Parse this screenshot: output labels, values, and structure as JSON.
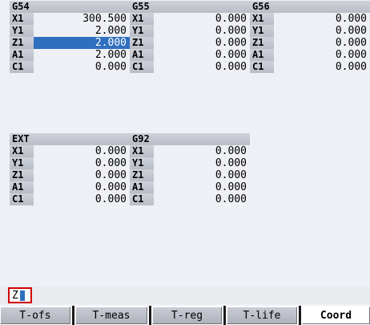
{
  "g54": {
    "title": "G54",
    "rows": [
      {
        "axis": "X1",
        "value": "300.500"
      },
      {
        "axis": "Y1",
        "value": "2.000"
      },
      {
        "axis": "Z1",
        "value": "2.000"
      },
      {
        "axis": "A1",
        "value": "2.000"
      },
      {
        "axis": "C1",
        "value": "0.000"
      }
    ]
  },
  "g55": {
    "title": "G55",
    "rows": [
      {
        "axis": "X1",
        "value": "0.000"
      },
      {
        "axis": "Y1",
        "value": "0.000"
      },
      {
        "axis": "Z1",
        "value": "0.000"
      },
      {
        "axis": "A1",
        "value": "0.000"
      },
      {
        "axis": "C1",
        "value": "0.000"
      }
    ]
  },
  "g56": {
    "title": "G56",
    "rows": [
      {
        "axis": "X1",
        "value": "0.000"
      },
      {
        "axis": "Y1",
        "value": "0.000"
      },
      {
        "axis": "Z1",
        "value": "0.000"
      },
      {
        "axis": "A1",
        "value": "0.000"
      },
      {
        "axis": "C1",
        "value": "0.000"
      }
    ]
  },
  "ext": {
    "title": "EXT",
    "rows": [
      {
        "axis": "X1",
        "value": "0.000"
      },
      {
        "axis": "Y1",
        "value": "0.000"
      },
      {
        "axis": "Z1",
        "value": "0.000"
      },
      {
        "axis": "A1",
        "value": "0.000"
      },
      {
        "axis": "C1",
        "value": "0.000"
      }
    ]
  },
  "g92": {
    "title": "G92",
    "rows": [
      {
        "axis": "X1",
        "value": "0.000"
      },
      {
        "axis": "Y1",
        "value": "0.000"
      },
      {
        "axis": "Z1",
        "value": "0.000"
      },
      {
        "axis": "A1",
        "value": "0.000"
      },
      {
        "axis": "C1",
        "value": "0.000"
      }
    ]
  },
  "input": {
    "value": "Z"
  },
  "softkeys": {
    "t_ofs": "T-ofs",
    "t_meas": "T-meas",
    "t_reg": "T-reg",
    "t_life": "T-life",
    "coord": "Coord"
  },
  "colors": {
    "selection": "#2f6fbf",
    "input_border": "#d40000",
    "header": "#c4c7ce"
  }
}
